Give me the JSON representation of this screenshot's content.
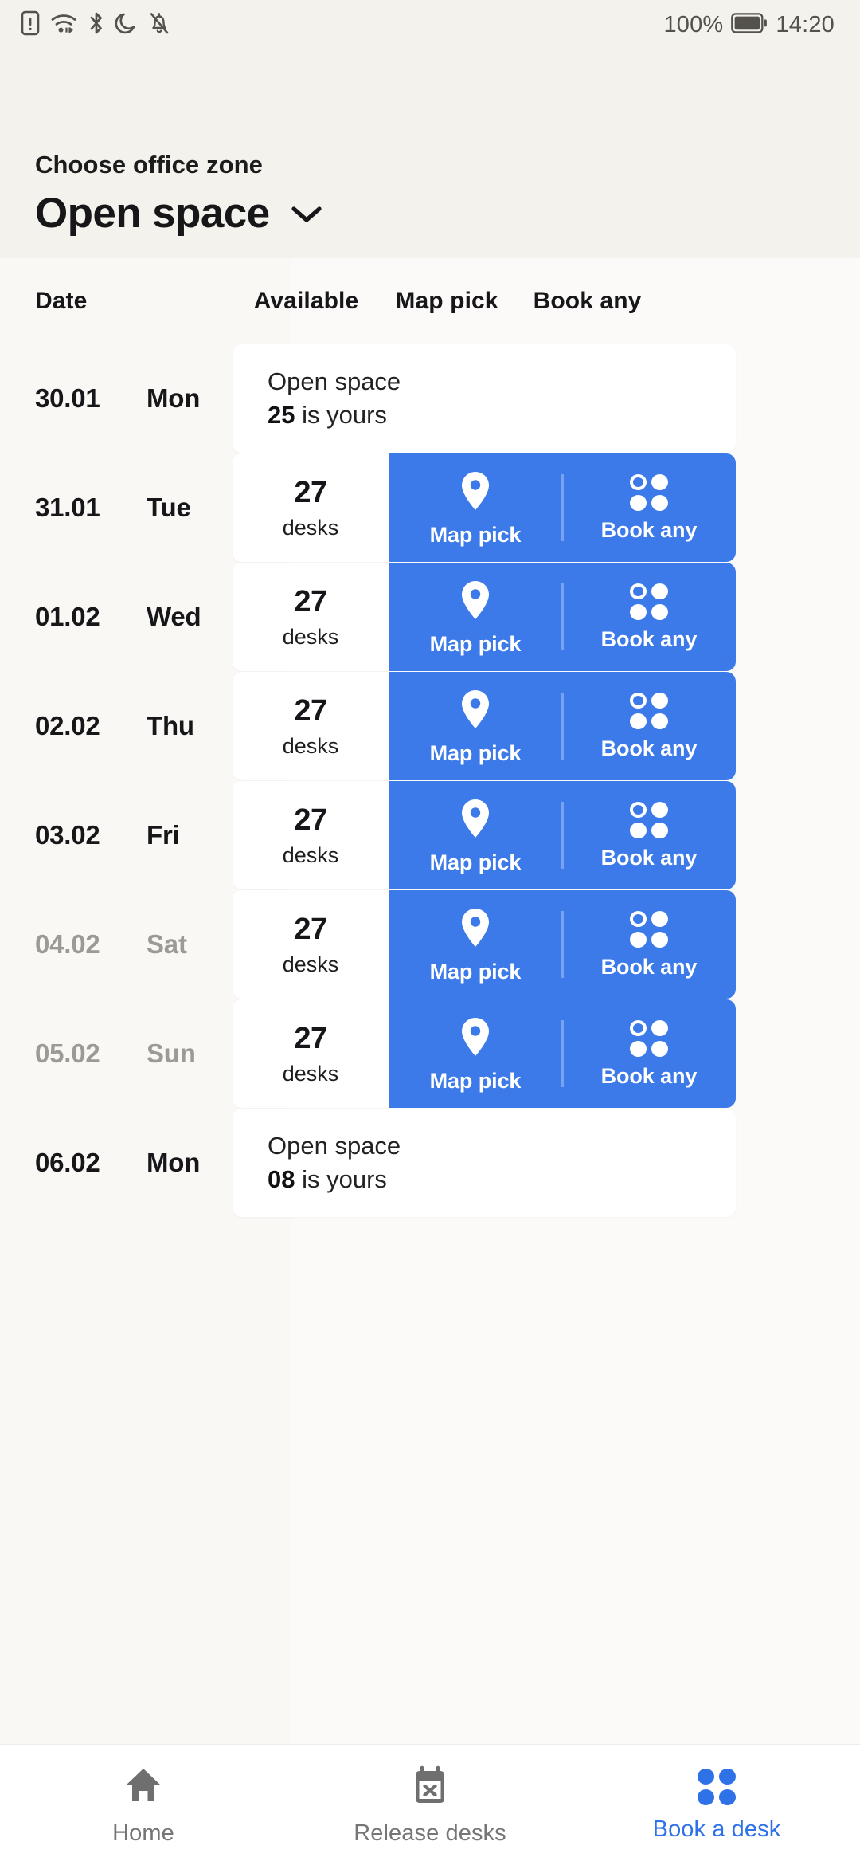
{
  "status_bar": {
    "icons": [
      "sim-alert-icon",
      "wifi-icon",
      "bluetooth-icon",
      "do-not-disturb-icon",
      "bell-muted-icon"
    ],
    "battery_percent": "100%",
    "time": "14:20"
  },
  "header": {
    "subtitle": "Choose office zone",
    "zone": "Open space",
    "dropdown_icon": "chevron-down-icon"
  },
  "table": {
    "columns": [
      "Date",
      "Available",
      "Map pick",
      "Book any"
    ],
    "desks_unit": "desks",
    "map_pick_label": "Map pick",
    "book_any_label": "Book any",
    "booked_suffix": "is yours",
    "rows": [
      {
        "date": "30.01",
        "day": "Mon",
        "weekend": false,
        "state": "booked",
        "zone": "Open space",
        "desk": "25"
      },
      {
        "date": "31.01",
        "day": "Tue",
        "weekend": false,
        "state": "available",
        "available": "27"
      },
      {
        "date": "01.02",
        "day": "Wed",
        "weekend": false,
        "state": "available",
        "available": "27"
      },
      {
        "date": "02.02",
        "day": "Thu",
        "weekend": false,
        "state": "available",
        "available": "27"
      },
      {
        "date": "03.02",
        "day": "Fri",
        "weekend": false,
        "state": "available",
        "available": "27"
      },
      {
        "date": "04.02",
        "day": "Sat",
        "weekend": true,
        "state": "available",
        "available": "27"
      },
      {
        "date": "05.02",
        "day": "Sun",
        "weekend": true,
        "state": "available",
        "available": "27"
      },
      {
        "date": "06.02",
        "day": "Mon",
        "weekend": false,
        "state": "booked",
        "zone": "Open space",
        "desk": "08"
      }
    ]
  },
  "bottom_nav": {
    "items": [
      {
        "label": "Home",
        "icon": "home-icon",
        "active": false
      },
      {
        "label": "Release desks",
        "icon": "calendar-x-icon",
        "active": false
      },
      {
        "label": "Book a desk",
        "icon": "four-dots-icon",
        "active": true
      }
    ]
  },
  "colors": {
    "accent_blue": "#3b7ae8",
    "nav_active_blue": "#2f72e8",
    "page_bg": "#faf8f5",
    "header_bg": "#f4f2ec",
    "card_white": "#ffffff",
    "text_primary": "#17171a",
    "text_muted": "#9c9a95"
  }
}
